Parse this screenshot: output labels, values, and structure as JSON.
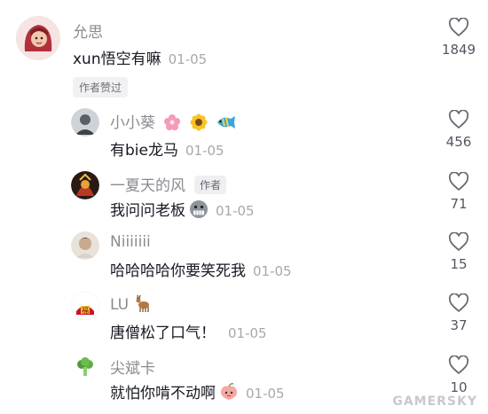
{
  "comments": [
    {
      "user": "允思",
      "text": "xun悟空有嘛",
      "date": "01-05",
      "likes": "1849",
      "badge": "作者赞过"
    },
    {
      "user": "小小葵",
      "text": "有bie龙马",
      "date": "01-05",
      "likes": "456",
      "emoji_name": [
        "cherry-blossom-icon",
        "sunflower-icon",
        "fish-icon"
      ]
    },
    {
      "user": "一夏天的风",
      "author_tag": "作者",
      "text": "我问问老板",
      "date": "01-05",
      "likes": "71",
      "emoji_name": "grimace-face-icon"
    },
    {
      "user": "Niiiiiii",
      "text": "哈哈哈哈你要笑死我",
      "date": "01-05",
      "likes": "15"
    },
    {
      "user": "LU",
      "text": "唐僧松了口气！",
      "date": "01-05",
      "likes": "37",
      "emoji_name": "deer-icon",
      "avatar_text": "福"
    },
    {
      "user": "尖斌卡",
      "text": "就怕你啃不动啊",
      "date": "01-05",
      "likes": "10",
      "emoji_name": "peach-face-icon"
    }
  ],
  "watermark": "GAMERSKY",
  "colors": {
    "username": "#8a8b91",
    "text": "#161823",
    "date": "#a7a8ad"
  }
}
